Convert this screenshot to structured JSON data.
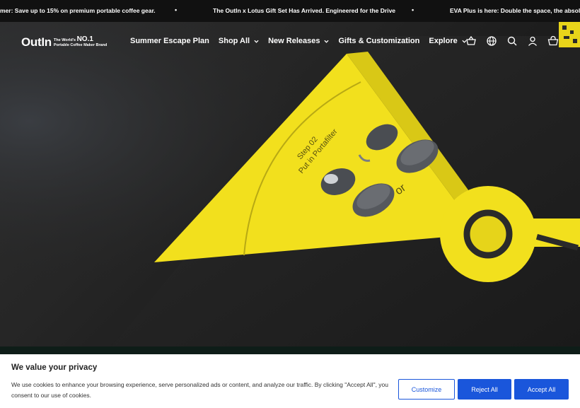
{
  "announcements": [
    "mer: Save up to 15% on premium portable coffee gear.",
    "The OutIn x Lotus Gift Set Has Arrived. Engineered for the Drive",
    "EVA Plus is here: Double the space, the absolute p"
  ],
  "logo": {
    "word": "OutIn",
    "tag_line1": "The World's",
    "tag_big": "NO.1",
    "tag_line2": "Portable Coffee Maker Brand"
  },
  "nav": [
    {
      "label": "Summer Escape Plan",
      "dropdown": false
    },
    {
      "label": "Shop All",
      "dropdown": true
    },
    {
      "label": "New Releases",
      "dropdown": true
    },
    {
      "label": "Gifts & Customization",
      "dropdown": false
    },
    {
      "label": "Explore",
      "dropdown": true
    }
  ],
  "header_icons": [
    "basket-icon",
    "globe-icon",
    "search-icon",
    "account-icon",
    "cart-icon"
  ],
  "hero": {
    "step_label": "Step 02",
    "step_text": "Put in Portafilter",
    "or_text": "or"
  },
  "cookie": {
    "title": "We value your privacy",
    "body": "We use cookies to enhance your browsing experience, serve personalized ads or content, and analyze our traffic. By clicking \"Accept All\", you consent to our use of cookies.",
    "customize_label": "Customize",
    "reject_label": "Reject All",
    "accept_label": "Accept All"
  },
  "colors": {
    "accent_yellow": "#f2e01d",
    "button_blue": "#1a56db",
    "announce_bg": "#111111"
  }
}
